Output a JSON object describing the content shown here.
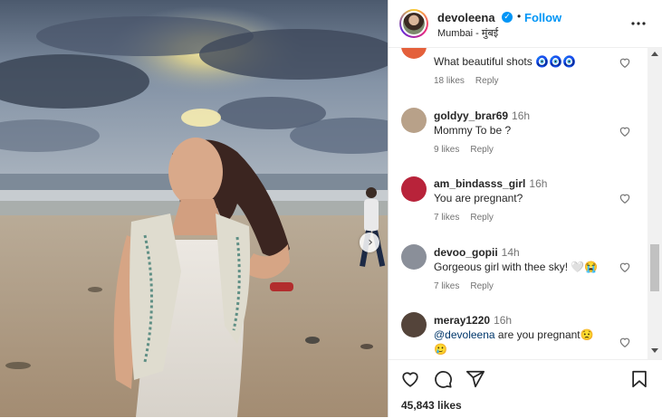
{
  "post": {
    "username": "devoleena",
    "verified_icon": "verified-badge-icon",
    "separator": "•",
    "follow_label": "Follow",
    "location": "Mumbai - मुंबई",
    "more_icon": "more-options-icon"
  },
  "photo": {
    "next_icon": "chevron-right-icon"
  },
  "comments": [
    {
      "user": "",
      "time": "",
      "text": "What beautiful shots 🧿🧿🧿",
      "likes": "18 likes",
      "reply": "Reply",
      "avatar_color": "#e4603b"
    },
    {
      "user": "goldyy_brar69",
      "time": "16h",
      "text": "Mommy To be ?",
      "likes": "9 likes",
      "reply": "Reply",
      "avatar_color": "#b8a189"
    },
    {
      "user": "am_bindasss_girl",
      "time": "16h",
      "text": "You are pregnant?",
      "likes": "7 likes",
      "reply": "Reply",
      "avatar_color": "#b8233a"
    },
    {
      "user": "devoo_gopii",
      "time": "14h",
      "text": "Gorgeous girl with thee sky! 🤍😭",
      "likes": "7 likes",
      "reply": "Reply",
      "avatar_color": "#8a8f99"
    },
    {
      "user": "meray1220",
      "time": "16h",
      "mention": "@devoleena",
      "text": " are you pregnant😟",
      "text2": "🥲",
      "avatar_color": "#54443a"
    }
  ],
  "actions": {
    "like_icon": "heart-icon",
    "comment_icon": "comment-icon",
    "share_icon": "share-icon",
    "save_icon": "bookmark-icon"
  },
  "likes_count": "45,843 likes"
}
